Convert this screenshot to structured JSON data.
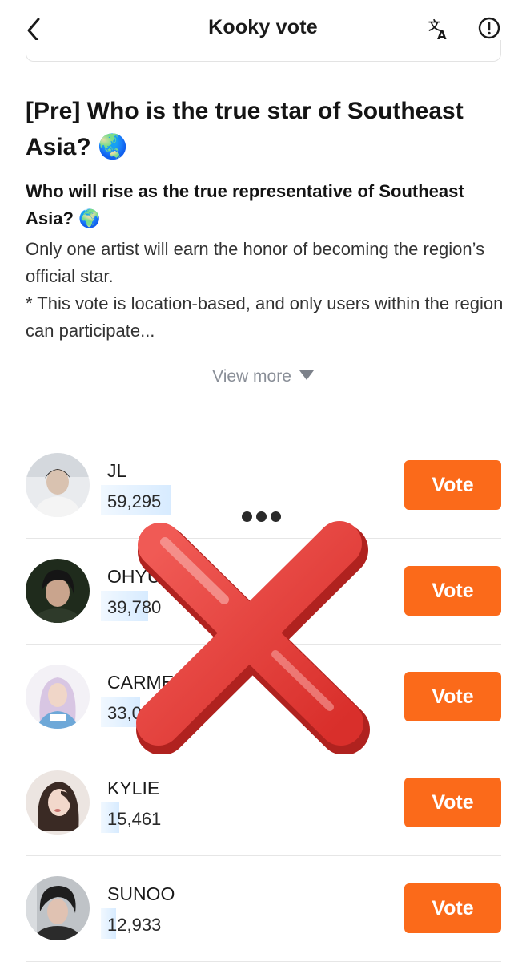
{
  "header": {
    "title": "Kooky vote",
    "translate_icon": "translate-icon",
    "info_icon": "info-circle-icon",
    "back_icon": "chevron-left-icon"
  },
  "vote": {
    "title": "[Pre] Who is the true star of Southeast Asia? 🌏",
    "description_heading": "Who will rise as the true representative of Southeast Asia? 🌍",
    "description_lines": [
      "Only one artist will earn the honor of becoming the region’s official star.",
      "* This vote is location-based, and only users within the region can participate..."
    ],
    "view_more_label": "View more"
  },
  "ranking": [
    {
      "name": "JL",
      "votes": "59,295",
      "share": 1.0,
      "button": "Vote"
    },
    {
      "name": "OHYU",
      "votes": "39,780",
      "share": 0.67,
      "button": "Vote"
    },
    {
      "name": "CARME",
      "votes": "33,0",
      "share": 0.56,
      "button": "Vote"
    },
    {
      "name": "KYLIE",
      "votes": "15,461",
      "share": 0.26,
      "button": "Vote"
    },
    {
      "name": "SUNOO",
      "votes": "12,933",
      "share": 0.22,
      "button": "Vote"
    }
  ],
  "overlay": {
    "dots_icon": "more-dots-icon",
    "cross_icon": "red-x-icon"
  },
  "colors": {
    "accent": "#fb6a1a",
    "bar": "#d7ebff",
    "cross": "#e8403c"
  }
}
